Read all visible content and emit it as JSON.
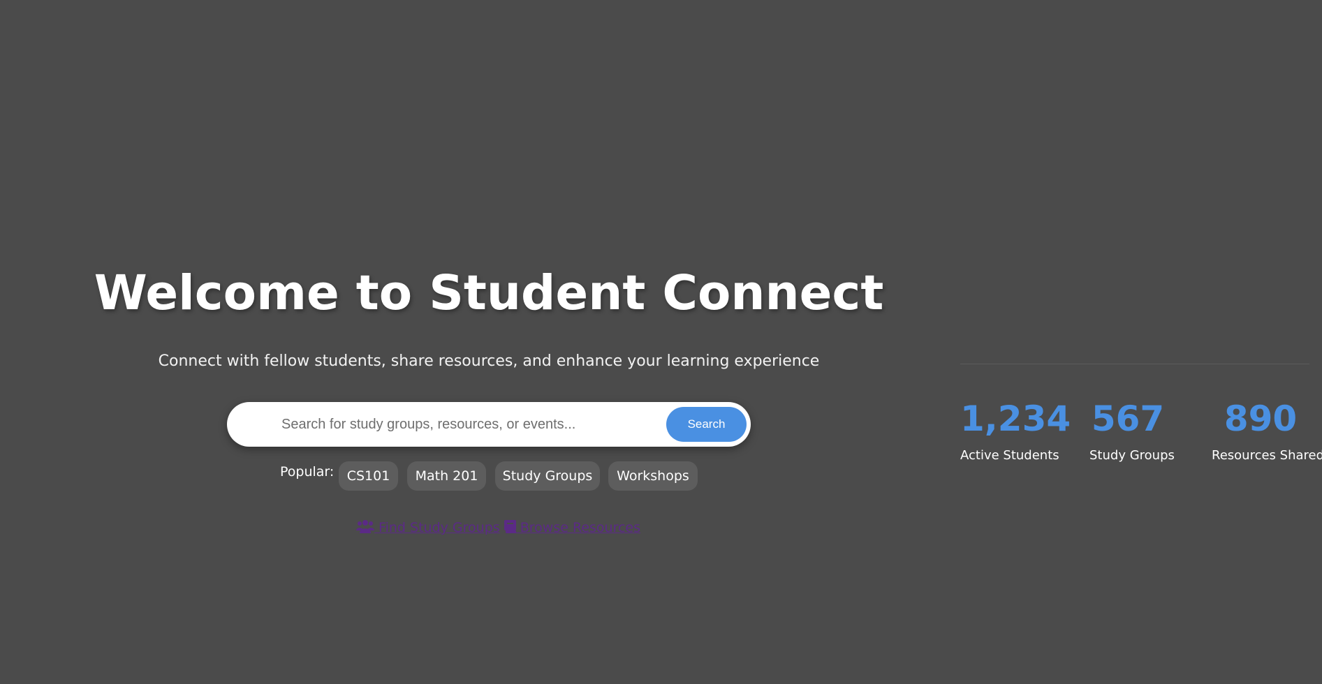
{
  "hero": {
    "title": "Welcome to Student Connect",
    "subtitle": "Connect with fellow students, share resources, and enhance your learning experience"
  },
  "search": {
    "placeholder": "Search for study groups, resources, or events...",
    "value": "",
    "button_label": "Search"
  },
  "popular": {
    "label": "Popular:",
    "tags": [
      "CS101",
      "Math 201",
      "Study Groups",
      "Workshops"
    ]
  },
  "quick_links": [
    {
      "label": "Find Study Groups",
      "icon": "users-icon"
    },
    {
      "label": "Browse Resources",
      "icon": "book-icon"
    }
  ],
  "stats": [
    {
      "value": "1,234",
      "label": "Active Students"
    },
    {
      "value": "567",
      "label": "Study Groups"
    },
    {
      "value": "890",
      "label": "Resources Shared"
    }
  ],
  "colors": {
    "background": "#4b4b4b",
    "accent": "#4a90e2",
    "link": "#5b2a86",
    "tag_background": "#5d5d5d"
  }
}
